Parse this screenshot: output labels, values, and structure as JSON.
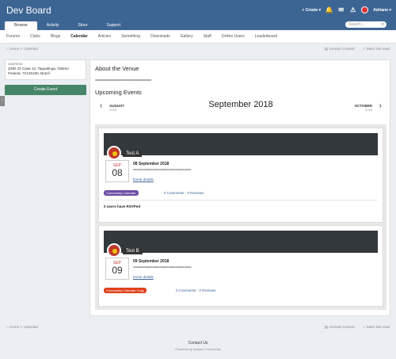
{
  "header": {
    "title": "Dev Board",
    "create_label": "Create",
    "user_name": "Adriano",
    "search_placeholder": "Search..."
  },
  "tabs": [
    "Browse",
    "Activity",
    "Store",
    "Support"
  ],
  "subnav": [
    "Forums",
    "Clubs",
    "Blogs",
    "Calendar",
    "Articles",
    "Something",
    "Downloads",
    "Gallery",
    "Staff",
    "Online Users",
    "Leaderboard"
  ],
  "breadcrumb": {
    "home": "Home",
    "current": "Calendar",
    "unread": "Unread Content",
    "mark_read": "Mark site read"
  },
  "sidebar": {
    "address_label": "ADDRESS",
    "address_line1": "QND 23 Casa 14, Taguatinga, Distrito",
    "address_line2": "Federal, 72125160, Brazil",
    "create_button": "Create Event"
  },
  "main": {
    "about_title": "About the Venue",
    "about_text": "aaaaaaaaaaaaaaaaaaaaaaaaaaaaaaaaaaa",
    "upcoming_title": "Upcoming Events",
    "prev_month": "AUGUST",
    "prev_year": "2018",
    "current_month": "September 2018",
    "next_month": "OCTOBER",
    "next_year": "2018"
  },
  "events": [
    {
      "name": "Test A",
      "month": "SEP",
      "day": "08",
      "date_text": "08 September 2018",
      "desc": "aaaaaaaaaaaaaaaaaaaaaaaaaaaaaaaaa",
      "details": "Event details",
      "calendar": "Community Calendar",
      "calendar_color": "#6b4fa3",
      "comments": "0 Comments · 0 Reviews",
      "rsvp": "0 users have RSVPed"
    },
    {
      "name": "Test B",
      "month": "SEP",
      "day": "09",
      "date_text": "09 September 2018",
      "desc": "aaaaaaaaaaaaaaaaaaaaaaaaaaaaaaaaa",
      "details": "Event details",
      "calendar": "Community Calendar Copy",
      "calendar_color": "#e0401a",
      "comments": "0 Comments · 0 Reviews"
    }
  ],
  "footer": {
    "contact": "Contact Us",
    "powered": "Powered by Invision Community"
  },
  "colors": {
    "header": "#3d6594",
    "create_button": "#478569"
  }
}
